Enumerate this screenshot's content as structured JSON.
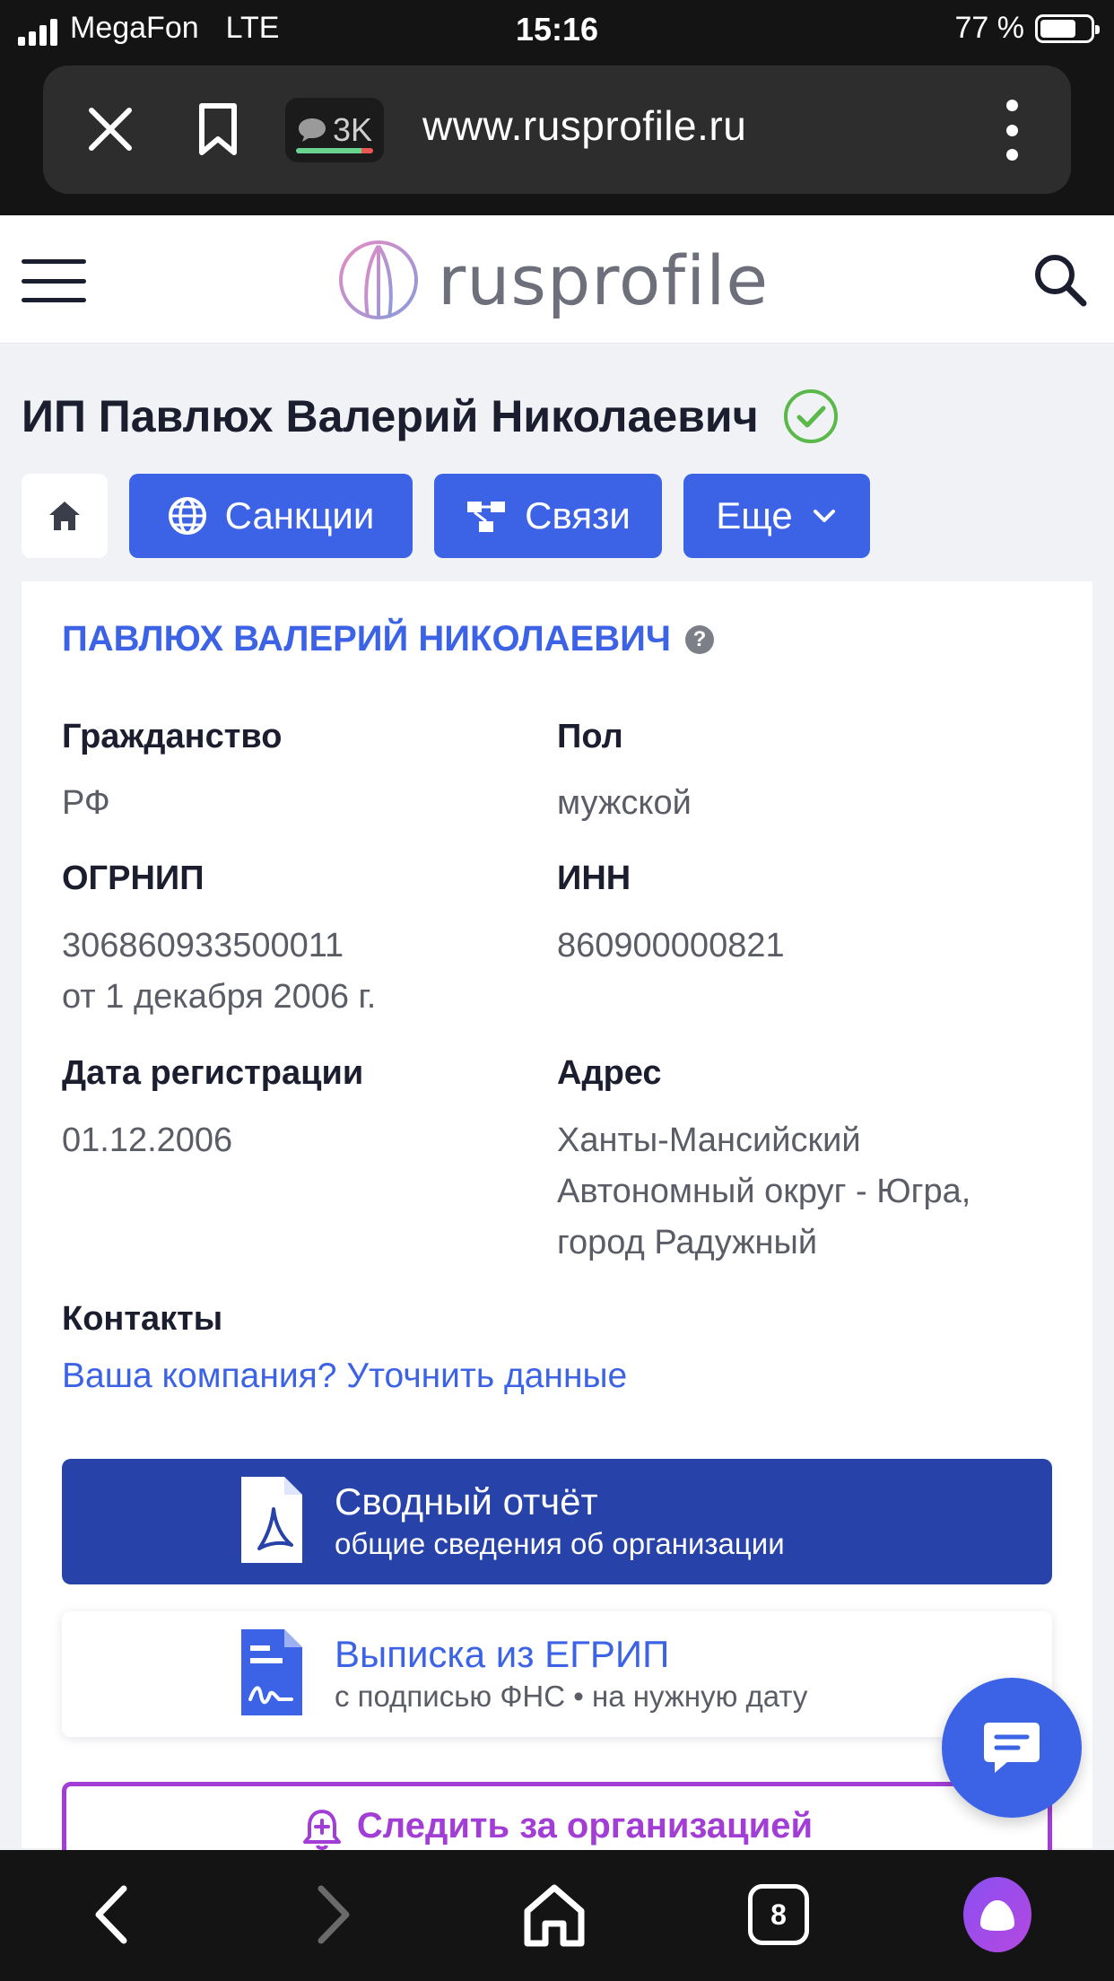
{
  "status_bar": {
    "carrier": "MegaFon",
    "network": "LTE",
    "time": "15:16",
    "battery": "77 %"
  },
  "browser": {
    "url": "www.rusprofile.ru",
    "comments_count": "3K",
    "open_tabs": "8"
  },
  "site": {
    "logo_text": "rusprofile"
  },
  "page": {
    "title": "ИП Павлюх Валерий Николаевич",
    "tabs": {
      "sanctions": "Санкции",
      "links": "Связи",
      "more": "Еще"
    }
  },
  "card": {
    "person_name": "ПАВЛЮХ ВАЛЕРИЙ НИКОЛАЕВИЧ",
    "help": "?",
    "citizenship": {
      "label": "Гражданство",
      "value": "РФ"
    },
    "gender": {
      "label": "Пол",
      "value": "мужской"
    },
    "ogrnip": {
      "label": "ОГРНИП",
      "value": "306860933500011",
      "date": "от 1 декабря 2006 г."
    },
    "inn": {
      "label": "ИНН",
      "value": "860900000821"
    },
    "reg_date": {
      "label": "Дата регистрации",
      "value": "01.12.2006"
    },
    "address": {
      "label": "Адрес",
      "line1": "Ханты-Мансийский",
      "line2": "Автономный округ - Югра,",
      "line3": "город Радужный"
    },
    "contacts": {
      "label": "Контакты",
      "link": "Ваша компания? Уточнить данные"
    },
    "report_button": {
      "title": "Сводный отчёт",
      "subtitle": "общие сведения об организации"
    },
    "extract_button": {
      "title": "Выписка из ЕГРИП",
      "subtitle": "с подписью ФНС • на нужную дату"
    },
    "follow_button": {
      "label": "Следить за организацией"
    }
  },
  "colors": {
    "accent": "#3c63e6",
    "dark_accent": "#2742a8",
    "follow": "#a23ed6",
    "check": "#5bb84a"
  },
  "icons": [
    "close-icon",
    "bookmark-icon",
    "comment-icon",
    "more-vertical-icon",
    "menu-icon",
    "search-icon",
    "verified-check-icon",
    "home-icon",
    "globe-icon",
    "network-icon",
    "chevron-down-icon",
    "help-icon",
    "pdf-icon",
    "document-signature-icon",
    "bell-plus-icon",
    "chat-icon",
    "back-icon",
    "forward-icon",
    "browser-home-icon",
    "tabs-icon",
    "alice-icon"
  ]
}
